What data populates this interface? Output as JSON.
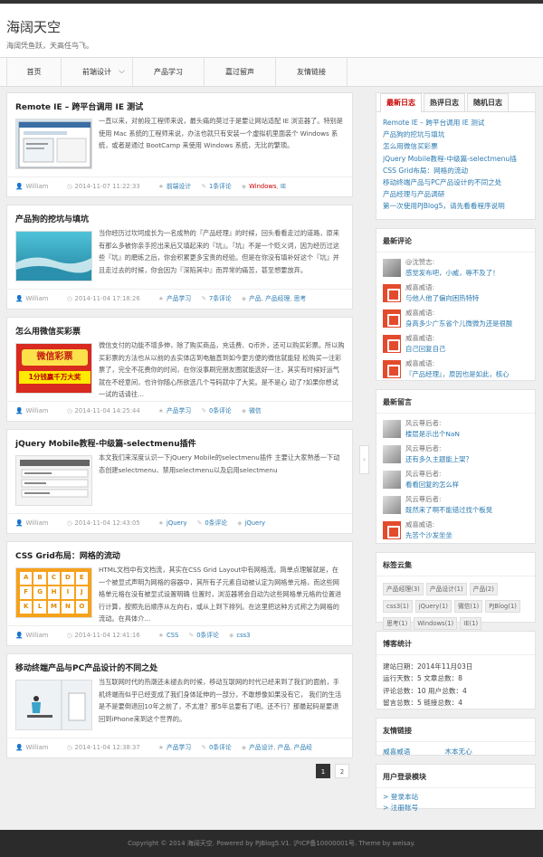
{
  "site": {
    "title": "海阔天空",
    "desc": "海阔凭鱼跃，天高任鸟飞。"
  },
  "nav": [
    {
      "label": "首页"
    },
    {
      "label": "前端设计"
    },
    {
      "label": "产品学习"
    },
    {
      "label": "嘉过留声"
    },
    {
      "label": "友情链接"
    }
  ],
  "posts": [
    {
      "title": "Remote IE – 跨平台调用 IE 测试",
      "excerpt": "一直以来，对前段工程师来说，最头痛的莫过于是要让网站适配 IE 浏览器了。特别是使用 Mac 系统的工程师来说，办法也就只有安装一个虚拟机里面装个 Windows 系统，或者是通过 BootCamp 来使用 Windows 系统，无比的繁琐。",
      "author": "William",
      "date": "2014-11-07 11:22:33",
      "category": "前端设计",
      "comments": "1条评论",
      "tags": [
        "Windows",
        "IE"
      ]
    },
    {
      "title": "产品狗的挖坑与填坑",
      "excerpt": "当你经历过坎坷成长为一名成熟的『产品经理』的时候，回头看看走过的道路，原来有那么多被你亲手挖出来后又填起来的『坑』。『坑』不是一个贬义词，因为经历过这些『坑』的磨练之后，你会积累更多宝贵的经验。但是在你没有填补好这个『坑』并且走过去的时候，你会因为『深陷其中』而异常的痛苦，甚至想要放弃。",
      "author": "William",
      "date": "2014-11-04 17:18:26",
      "category": "产品学习",
      "comments": "7条评论",
      "tags": [
        "产品",
        "产品经理",
        "思考"
      ]
    },
    {
      "title": "怎么用微信买彩票",
      "excerpt": "微信支付的功能不增多伸，除了购买商品，充话费、Q币外，还可以购买彩票。所以购买彩票的方法也从以前的去实体店到电脑直到如今更方便的微信就能轻 松购买一注彩票了，完全不花费你的时间，在你没事刷完朋友圈就能选好一注，其实有时候好运气就在不经意间，也许你随心所欲选几个号码就中了大奖。是不是心 动了?如果你想试一试的话请往...",
      "author": "William",
      "date": "2014-11-04 14:25:44",
      "category": "产品学习",
      "comments": "0条评论",
      "tags": [
        "微信"
      ],
      "thumb_text": "微信彩票",
      "thumb_sub": "1分钱赢千万大奖"
    },
    {
      "title": "jQuery Mobile教程-中级篇-selectmenu插件",
      "excerpt": "本文我们来深度认识一下jQuery Mobile的selectmenu插件 主要让大家熟悉一下动态创建selectmenu、禁用selectmenu以及启用selectmenu",
      "author": "William",
      "date": "2014-11-04 12:43:05",
      "category": "jQuery",
      "comments": "0条评论",
      "tags": [
        "jQuery"
      ]
    },
    {
      "title": "CSS Grid布局：网格的流动",
      "excerpt": "HTML文档中有文档流，其实在CSS Grid Layout中有网格流。简单点理解就是，在一个被显式声明为网格的容器中，其所有子元素自动被认定为网格单元格，而这些网格单元格在没有被显式设置明确 位置时，浏览器将会自动为这些网格单元格的位置进行计算，按照先后顺序从左向右，或从上到下排列。在这里把这种方式称之为网格的流动。在具体介...",
      "author": "William",
      "date": "2014-11-04 12:41:16",
      "category": "CSS",
      "comments": "0条评论",
      "tags": [
        "css3"
      ],
      "grid_letters": [
        "A",
        "B",
        "C",
        "D",
        "E",
        "F",
        "G",
        "H",
        "I",
        "J",
        "K",
        "L",
        "M",
        "N",
        "O"
      ]
    },
    {
      "title": "移动终端产品与PC产品设计的不同之处",
      "excerpt": "当互联网时代的热潮还未褪去的时候，移动互联网的时代已经来到了我们的面前，手机终端而似乎已经变成了我们身体延伸的一部分，不敢想像如果没有它， 我们的生活是不是要倒退回10年之前了，不太准？那5年总要有了吧。还不行？那最起码是要退回到iPhone来到这个世界的。",
      "author": "William",
      "date": "2014-11-04 12:38:37",
      "category": "产品学习",
      "comments": "0条评论",
      "tags": [
        "产品设计",
        "产品",
        "产品经"
      ]
    }
  ],
  "pagination": [
    "1",
    "2"
  ],
  "sidebar": {
    "tabs": [
      "最新日志",
      "热评日志",
      "随机日志"
    ],
    "recent_posts": [
      "Remote IE – 跨平台调用 IE 测试",
      "产品狗的挖坑与填坑",
      "怎么用微信买彩票",
      "jQuery Mobile教程-中级篇-selectmenu插",
      "CSS Grid布局：网格的流动",
      "移动终端产品与PC产品设计的不同之处",
      "产品经理与产品调研",
      "第一次使用PJBlog5，请先看看程序说明"
    ],
    "recent_comments_title": "最新评论",
    "recent_comments": [
      {
        "who": "@沈赞志:",
        "text": "感觉发布吧，小威，辱不及了！"
      },
      {
        "who": "威喜威语:",
        "text": "与他人他了偏向困热特特"
      },
      {
        "who": "威喜威语:",
        "text": "身高多少广东省个儿微微为还是很酸"
      },
      {
        "who": "威喜威语:",
        "text": "自己回复自己"
      },
      {
        "who": "威喜威语:",
        "text": "『产品经理』，原因也是如此，核心"
      }
    ],
    "recent_messages_title": "最新留言",
    "recent_messages": [
      {
        "who": "风云尊后者:",
        "text": "楼层是示出个NaN"
      },
      {
        "who": "风云尊后者:",
        "text": "还有多久主题能上架？"
      },
      {
        "who": "风云尊后者:",
        "text": "看看回复的怎么样"
      },
      {
        "who": "风云尊后者:",
        "text": "既然来了啊不能错过找个板凳"
      },
      {
        "who": "威喜威语:",
        "text": "先苦个沙发坐坐"
      }
    ],
    "tag_cloud_title": "标签云集",
    "tag_cloud": [
      "产品经理(3)",
      "产品设计(1)",
      "产品(2)",
      "css3(1)",
      "jQuery(1)",
      "微信(1)",
      "PJBlog(1)",
      "思考(1)",
      "Windows(1)",
      "IE(1)"
    ],
    "stats_title": "博客统计",
    "stats": [
      "建站日期：2014年11月03日",
      "运行天数：5    文章总数：8",
      "评论总数：10    用户总数：4",
      "留言总数：5    链接总数：4"
    ],
    "links_title": "友情链接",
    "links": [
      "威喜威语",
      "木本无心"
    ],
    "login_title": "用户登录模块",
    "login_links": [
      "> 登录本站",
      "> 注册账号"
    ]
  },
  "footer": "Copyright © 2014 海阔天空. Powered by PJBlog5.V1. 沪ICP备10000001号. Theme by weisay.",
  "colors": {
    "link": "#2a7ab0",
    "accent_red": "#c00000",
    "footer_bg": "#2b2b2b"
  }
}
